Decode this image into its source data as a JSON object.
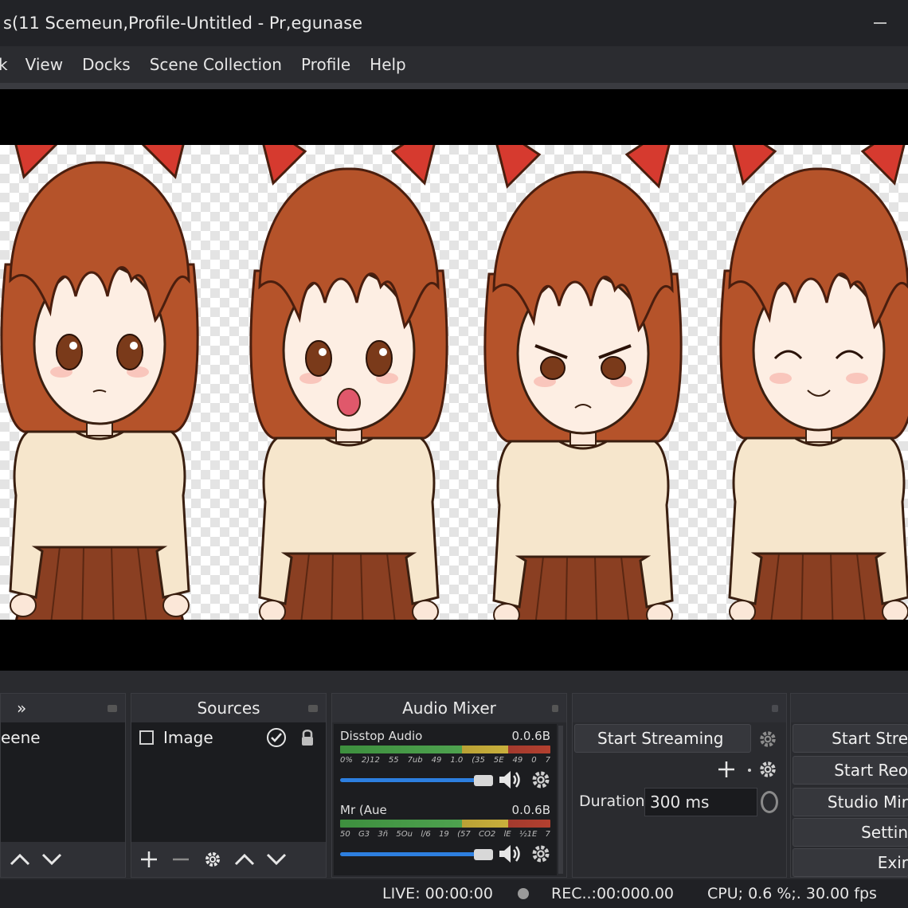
{
  "window": {
    "title": "s(11 Scemeun,Profile-Untitled - Pr,egunase"
  },
  "menu": {
    "items": [
      "k",
      "View",
      "Docks",
      "Scene Collection",
      "Profile",
      "Help"
    ]
  },
  "scenes": {
    "header": "»",
    "items": [
      "eene"
    ]
  },
  "sources": {
    "header": "Sources",
    "items": [
      {
        "label": "Image",
        "visible": true,
        "locked": true
      }
    ]
  },
  "audio_mixer": {
    "header": "Audio Mixer",
    "channels": [
      {
        "name": "Disstop Audio",
        "db": "0.0.6B",
        "ticks": [
          "0%",
          "2)12",
          "55",
          "7ub",
          "49",
          "1.0",
          "(35",
          "5E",
          "49",
          "0",
          "7"
        ],
        "volume": 0.93
      },
      {
        "name": "Mr (Aue",
        "db": "0.0.6B",
        "ticks": [
          "50",
          "G3",
          "3ñ",
          "5Ou",
          "l/6",
          "19",
          "(57",
          "CO2",
          "lE",
          "½1E",
          "7"
        ],
        "volume": 0.93
      }
    ]
  },
  "transitions": {
    "start_streaming": "Start Streaming",
    "duration_label": "Duration",
    "duration_value": "300 ms"
  },
  "controls": {
    "buttons": [
      "Start Stre",
      "Start Reo",
      "Studio Mir",
      "Settin",
      "Exir"
    ]
  },
  "status": {
    "live": "LIVE: 00:00:00",
    "rec": "REC..:00:000.00",
    "cpu": "CPU; 0.6 %;. 30.00 fps"
  },
  "colors": {
    "hair": "#b5532a",
    "bow": "#d63a2f",
    "sweater": "#f6e6cc",
    "skirt": "#8a3f22",
    "meter_green": "#4ea24f",
    "slider_blue": "#2d7fe0"
  },
  "preview": {
    "characters": [
      "neutral",
      "surprised",
      "angry",
      "happy"
    ]
  }
}
